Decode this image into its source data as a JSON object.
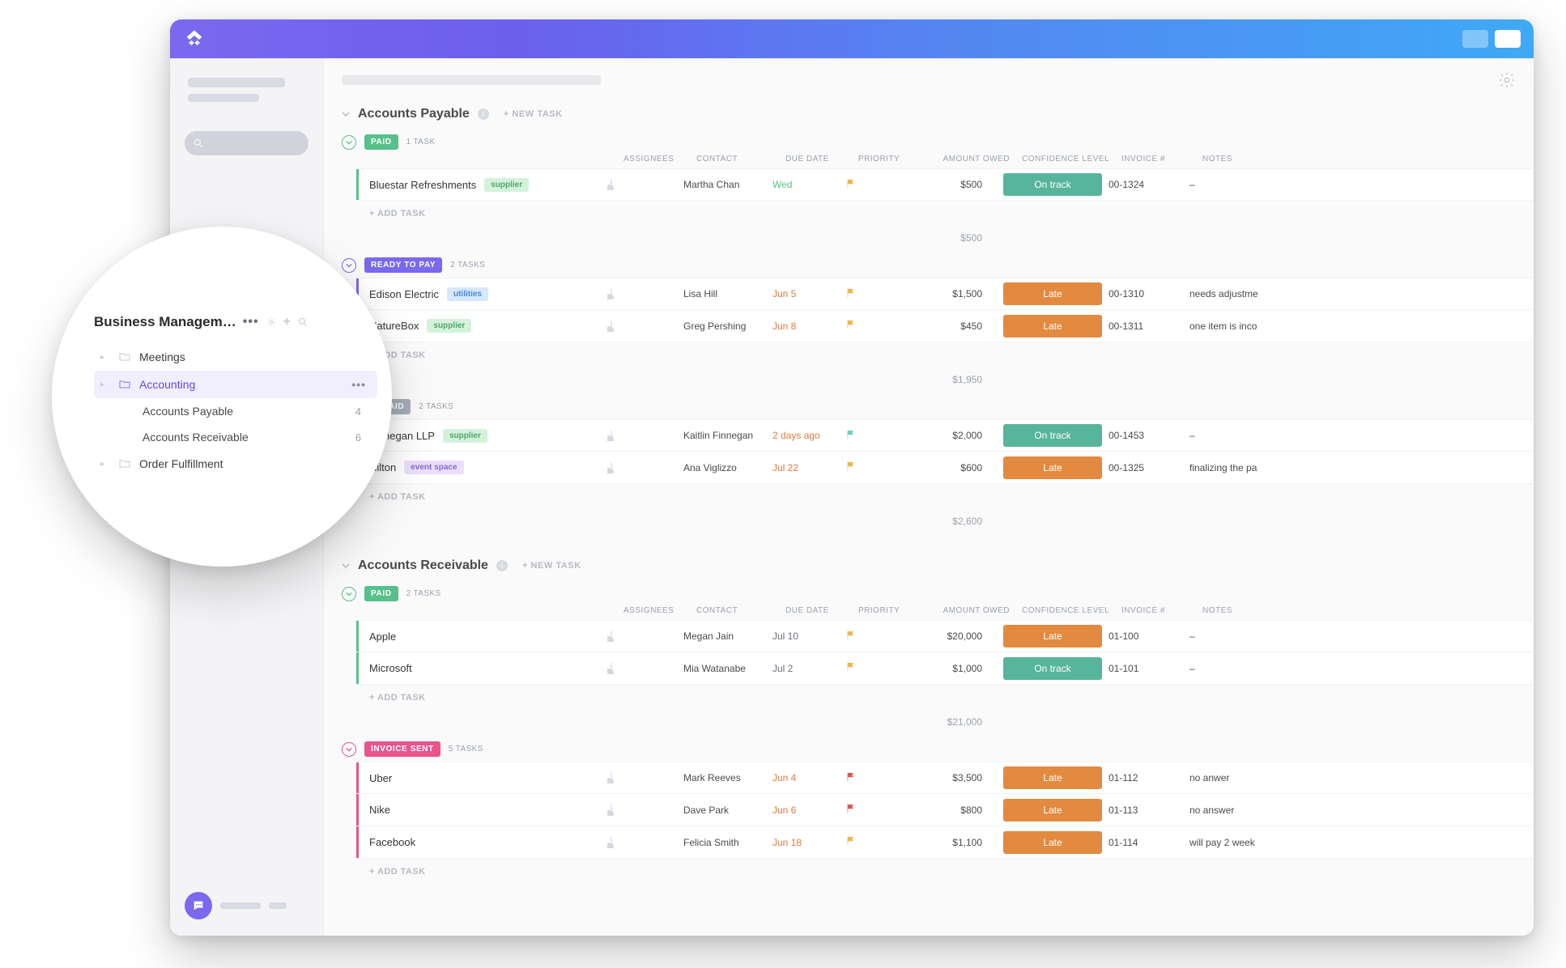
{
  "colors": {
    "paid": "#57c08b",
    "readyToPay": "#7b68ee",
    "unpaid": "#a7adba",
    "invoiceSent": "#e8548e",
    "onTrack": "#57b59b",
    "late": "#e28a3f",
    "supplierChipBg": "#d4f2db",
    "supplierChipFg": "#4fa56a",
    "utilitiesChipBg": "#d6e8fb",
    "utilitiesChipFg": "#4a86d6",
    "eventChipBg": "#eadffb",
    "eventChipFg": "#8a68d0",
    "flagYellow": "#f0b54a",
    "flagTeal": "#6ccfc4",
    "flagRed": "#e05656"
  },
  "newTaskLabel": "+ NEW TASK",
  "addTaskLabel": "+ ADD TASK",
  "columns": {
    "assignees": "ASSIGNEES",
    "contact": "CONTACT",
    "dueDate": "DUE DATE",
    "priority": "PRIORITY",
    "amountOwed": "AMOUNT OWED",
    "confidence": "CONFIDENCE LEVEL",
    "invoice": "INVOICE #",
    "notes": "NOTES"
  },
  "lists": [
    {
      "title": "Accounts Payable",
      "groups": [
        {
          "status": "PAID",
          "statusColorKey": "paid",
          "countLabel": "1 TASK",
          "subtotal": "$500",
          "tasks": [
            {
              "name": "Bluestar Refreshments",
              "tag": "supplier",
              "tagBg": "supplierChipBg",
              "tagFg": "supplierChipFg",
              "contact": "Martha Chan",
              "due": "Wed",
              "dueClass": "due-green",
              "flag": "flagYellow",
              "amount": "$500",
              "confidence": "On track",
              "confKey": "onTrack",
              "invoice": "00-1324",
              "notes": "–"
            }
          ]
        },
        {
          "status": "READY TO PAY",
          "statusColorKey": "readyToPay",
          "countLabel": "2 TASKS",
          "subtotal": "$1,950",
          "tasks": [
            {
              "name": "Edison Electric",
              "tag": "utilities",
              "tagBg": "utilitiesChipBg",
              "tagFg": "utilitiesChipFg",
              "contact": "Lisa Hill",
              "due": "Jun 5",
              "dueClass": "due-orange",
              "flag": "flagYellow",
              "amount": "$1,500",
              "confidence": "Late",
              "confKey": "late",
              "invoice": "00-1310",
              "notes": "needs adjustme"
            },
            {
              "name": "NatureBox",
              "tag": "supplier",
              "tagBg": "supplierChipBg",
              "tagFg": "supplierChipFg",
              "contact": "Greg Pershing",
              "due": "Jun 8",
              "dueClass": "due-orange",
              "flag": "flagYellow",
              "amount": "$450",
              "confidence": "Late",
              "confKey": "late",
              "invoice": "00-1311",
              "notes": "one item is inco"
            }
          ]
        },
        {
          "status": "UNPAID",
          "statusColorKey": "unpaid",
          "countLabel": "2 TASKS",
          "subtotal": "$2,600",
          "tasks": [
            {
              "name": "Finnegan LLP",
              "tag": "supplier",
              "tagBg": "supplierChipBg",
              "tagFg": "supplierChipFg",
              "contact": "Kaitlin Finnegan",
              "due": "2 days ago",
              "dueClass": "due-orange",
              "flag": "flagTeal",
              "amount": "$2,000",
              "confidence": "On track",
              "confKey": "onTrack",
              "invoice": "00-1453",
              "notes": "–"
            },
            {
              "name": "Hilton",
              "tag": "event space",
              "tagBg": "eventChipBg",
              "tagFg": "eventChipFg",
              "contact": "Ana Viglizzo",
              "due": "Jul 22",
              "dueClass": "due-orange",
              "flag": "flagYellow",
              "amount": "$600",
              "confidence": "Late",
              "confKey": "late",
              "invoice": "00-1325",
              "notes": "finalizing the pa"
            }
          ]
        }
      ]
    },
    {
      "title": "Accounts Receivable",
      "groups": [
        {
          "status": "PAID",
          "statusColorKey": "paid",
          "countLabel": "2 TASKS",
          "subtotal": "$21,000",
          "tasks": [
            {
              "name": "Apple",
              "tag": "",
              "contact": "Megan Jain",
              "due": "Jul 10",
              "dueClass": "due-grey",
              "flag": "flagYellow",
              "amount": "$20,000",
              "confidence": "Late",
              "confKey": "late",
              "invoice": "01-100",
              "notes": "–"
            },
            {
              "name": "Microsoft",
              "tag": "",
              "contact": "Mia Watanabe",
              "due": "Jul 2",
              "dueClass": "due-grey",
              "flag": "flagYellow",
              "amount": "$1,000",
              "confidence": "On track",
              "confKey": "onTrack",
              "invoice": "01-101",
              "notes": "–"
            }
          ]
        },
        {
          "status": "INVOICE SENT",
          "statusColorKey": "invoiceSent",
          "countLabel": "5 TASKS",
          "subtotal": "",
          "tasks": [
            {
              "name": "Uber",
              "tag": "",
              "contact": "Mark Reeves",
              "due": "Jun 4",
              "dueClass": "due-orange",
              "flag": "flagRed",
              "amount": "$3,500",
              "confidence": "Late",
              "confKey": "late",
              "invoice": "01-112",
              "notes": "no anwer"
            },
            {
              "name": "Nike",
              "tag": "",
              "contact": "Dave Park",
              "due": "Jun 6",
              "dueClass": "due-orange",
              "flag": "flagRed",
              "amount": "$800",
              "confidence": "Late",
              "confKey": "late",
              "invoice": "01-113",
              "notes": "no answer"
            },
            {
              "name": "Facebook",
              "tag": "",
              "contact": "Felicia Smith",
              "due": "Jun 18",
              "dueClass": "due-orange",
              "flag": "flagYellow",
              "amount": "$1,100",
              "confidence": "Late",
              "confKey": "late",
              "invoice": "01-114",
              "notes": "will pay 2 week"
            }
          ]
        }
      ]
    }
  ],
  "zoom": {
    "title": "Business Managem…",
    "items": [
      {
        "label": "Meetings",
        "type": "folder"
      },
      {
        "label": "Accounting",
        "type": "folder",
        "selected": true,
        "children": [
          {
            "label": "Accounts Payable",
            "count": "4"
          },
          {
            "label": "Accounts Receivable",
            "count": "6"
          }
        ]
      },
      {
        "label": "Order Fulfillment",
        "type": "folder"
      }
    ]
  }
}
